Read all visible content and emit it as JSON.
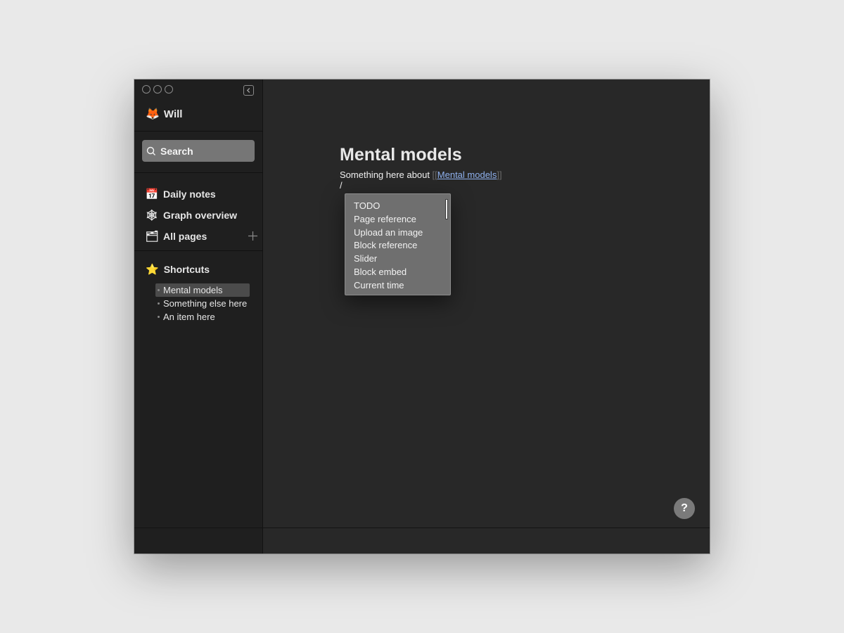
{
  "sidebar": {
    "user": {
      "name": "Will",
      "avatar_emoji": "🦊"
    },
    "search": {
      "label": "Search",
      "icon": "search-icon"
    },
    "nav": [
      {
        "label": "Daily notes",
        "emoji": "📅",
        "icon": "calendar-icon"
      },
      {
        "label": "Graph overview",
        "emoji": "🕸",
        "icon": "graph-icon"
      },
      {
        "label": "All pages",
        "emoji": "🗂",
        "icon": "folder-icon"
      }
    ],
    "shortcuts": {
      "label": "Shortcuts",
      "emoji": "⭐",
      "items": [
        {
          "label": "Mental models",
          "active": true
        },
        {
          "label": "Something else here",
          "active": false
        },
        {
          "label": "An item here",
          "active": false
        }
      ]
    }
  },
  "main": {
    "title": "Mental models",
    "block": {
      "text_before": "Something here about ",
      "open_bracket": "[[",
      "link": "Mental models",
      "close_bracket": "]]"
    },
    "slash_input": "/",
    "command_menu": [
      "TODO",
      "Page reference",
      "Upload an image",
      "Block reference",
      "Slider",
      "Block embed",
      "Current time"
    ],
    "help_label": "?"
  },
  "colors": {
    "sidebar_bg": "#1f1f1f",
    "main_bg": "#282828",
    "link": "#8fb1ee",
    "popup_bg": "#6f6f6f"
  }
}
